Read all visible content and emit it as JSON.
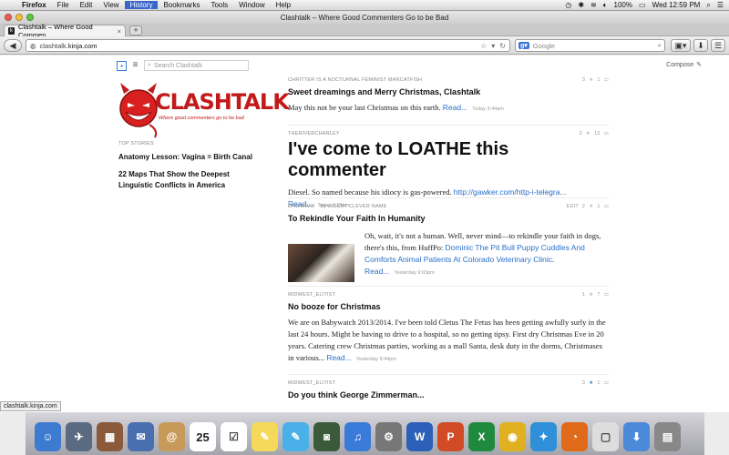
{
  "menubar": {
    "app": "Firefox",
    "items": [
      "File",
      "Edit",
      "View",
      "History",
      "Bookmarks",
      "Tools",
      "Window",
      "Help"
    ],
    "battery": "100%",
    "clock": "Wed 12:59 PM"
  },
  "window": {
    "title": "Clashtalk – Where Good Commenters Go to be Bad"
  },
  "tab": {
    "label": "Clashtalk – Where Good Commen..."
  },
  "navbar": {
    "url_prefix": "clashtalk.",
    "url_host": "kinja.com",
    "search_engine": "Google",
    "search_placeholder": "Google"
  },
  "page": {
    "site_search_placeholder": "Search Clashtalk",
    "compose_label": "Compose",
    "logo_text": "CLASHTALK",
    "logo_tagline": "Where good commenters go to be bad",
    "top_stories_heading": "TOP STORIES",
    "top_stories": [
      "Anatomy Lesson: Vagina = Birth Canal",
      "22 Maps That Show the Deepest Linguistic Conflicts in America"
    ]
  },
  "posts": [
    {
      "author": "CHRITTER IS A NOCTURNAL FEMINIST MANCATFISH",
      "stars": "3",
      "comments": "1",
      "title": "Sweet dreamings and Merry Christmas, Clashtalk",
      "body": "May this not be your last Christmas on this earth.",
      "read_more": "Read...",
      "time": "Today 3:44am"
    },
    {
      "author": "THERIVERCHARLEY",
      "stars": "2",
      "comments": "12",
      "title": "I've come to LOATHE this commenter",
      "body": "Diesel. So named because his idiocy is gas-powered.",
      "link": "http://gawker.com/http-i-telegra...",
      "read_more": "Read...",
      "time": "Today 1:15am"
    },
    {
      "author": "DAWWWW",
      "byline": "By INSERT CLEVER NAME",
      "edit": "EDIT",
      "stars": "2",
      "comments": "1",
      "title": "To Rekindle Your Faith In Humanity",
      "body": "Oh, wait, it's not a human. Well, never mind—to rekindle your faith in dogs, there's this, from HuffPo:",
      "link": "Dominic The Pit Bull Puppy Cuddles And Comforts Animal Patients At Colorado Veterinary Clinic",
      "body_end": ".",
      "read_more": "Read...",
      "time": "Yesterday 9:03pm"
    },
    {
      "author": "MIDWEST_ELITIST",
      "stars": "1",
      "comments": "7",
      "title": "No booze for Christmas",
      "body": "We are on Babywatch 2013/2014. I've been told Cletus The Fetus has been getting awfully surly in the last 24 hours. Might be having to drive to a hospital, so no getting tipsy. First dry Christmas Eve in 20 years. Catering crew Christmas parties, working as a mall Santa, desk duty in the dorms, Christmases in various...",
      "read_more": "Read...",
      "time": "Yesterday 8:44pm"
    },
    {
      "author": "MIDWEST_ELITIST",
      "stars": "3",
      "comments": "1",
      "title": "Do you think George Zimmerman..."
    }
  ],
  "statusbar": {
    "text": "clashtalk.kinja.com"
  },
  "dock": {
    "icons": [
      "finder-icon",
      "launchpad-icon",
      "photo-icon",
      "mail-icon",
      "contacts-icon",
      "calendar-icon",
      "reminders-icon",
      "notes-icon",
      "messages-icon",
      "facetime-icon",
      "itunes-icon",
      "system-preferences-icon",
      "word-icon",
      "powerpoint-icon",
      "excel-icon",
      "chrome-icon",
      "safari-icon",
      "firefox-icon",
      "preview-icon",
      "downloads-icon",
      "trash-icon"
    ],
    "calendar_day": "25",
    "colors": [
      "#3d7bd1",
      "#5a6a80",
      "#8a5a3a",
      "#4a6fb0",
      "#c89a5a",
      "#ffffff",
      "#ffffff",
      "#f5d95a",
      "#4ab0e8",
      "#3a5a3a",
      "#3a7ad8",
      "#777777",
      "#2b5fb8",
      "#d14b26",
      "#1f8a3e",
      "#e0b020",
      "#2f8fd8",
      "#e06a1a",
      "#dddddd",
      "#4a8ad8",
      "#888888"
    ]
  }
}
